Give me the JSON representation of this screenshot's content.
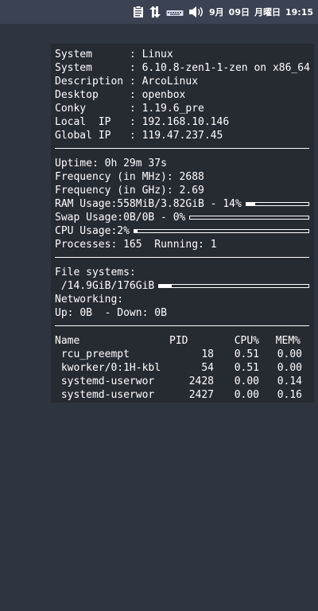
{
  "topbar": {
    "icons": [
      "clipboard-icon",
      "network-arrows-icon",
      "keyboard-icon",
      "volume-icon"
    ],
    "month": "9月",
    "day": "09日",
    "weekday": "月曜日",
    "time": "19:15"
  },
  "conky": {
    "system_info": [
      {
        "label": "System     ",
        "value": "Linux"
      },
      {
        "label": "System     ",
        "value": "6.10.8-zen1-1-zen on x86_64"
      },
      {
        "label": "Description",
        "value": "ArcoLinux"
      },
      {
        "label": "Desktop    ",
        "value": "openbox"
      },
      {
        "label": "Conky      ",
        "value": "1.19.6_pre"
      },
      {
        "label": "Local  IP  ",
        "value": "192.168.10.146"
      },
      {
        "label": "Global IP  ",
        "value": "119.47.237.45"
      }
    ],
    "uptime": {
      "label": "Uptime:",
      "value": "0h 29m 37s"
    },
    "freq_mhz": {
      "label": "Frequency (in MHz):",
      "value": "2688"
    },
    "freq_ghz": {
      "label": "Frequency (in GHz):",
      "value": "2.69"
    },
    "ram": {
      "label": "RAM Usage:",
      "value": "558MiB/3.82GiB - 14%",
      "percent": 14
    },
    "swap": {
      "label": "Swap Usage:",
      "value": "0B/0B - 0%",
      "percent": 0
    },
    "cpu": {
      "label": "CPU Usage:",
      "value": "2%",
      "percent": 2
    },
    "processes": {
      "label": "Processes:",
      "value": "165",
      "running_label": "Running:",
      "running_value": "1"
    },
    "filesystems": {
      "label": "File systems:",
      "mount": "/",
      "usage": "14.9GiB/176GiB",
      "percent": 8.5
    },
    "networking": {
      "label": "Networking:",
      "up_label": "Up:",
      "up_value": "0B",
      "down_label": "- Down:",
      "down_value": "0B"
    },
    "process_table": {
      "headers": {
        "name": "Name",
        "pid": "PID",
        "cpu": "CPU%",
        "mem": "MEM%"
      },
      "rows": [
        {
          "name": "rcu_preempt",
          "pid": "18",
          "cpu": "0.51",
          "mem": "0.00"
        },
        {
          "name": "kworker/0:1H-kbl",
          "pid": "54",
          "cpu": "0.51",
          "mem": "0.00"
        },
        {
          "name": "systemd-userwor",
          "pid": "2428",
          "cpu": "0.00",
          "mem": "0.14"
        },
        {
          "name": "systemd-userwor",
          "pid": "2427",
          "cpu": "0.00",
          "mem": "0.16"
        }
      ]
    }
  }
}
